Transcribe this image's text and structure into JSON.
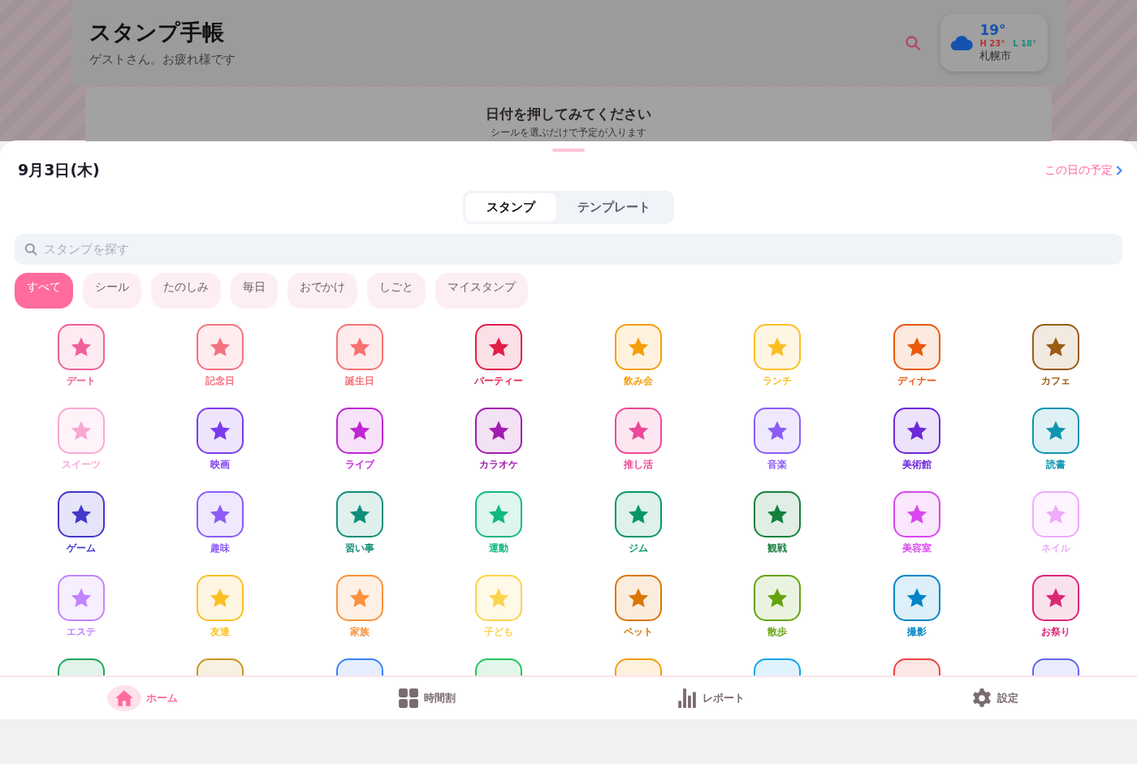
{
  "header": {
    "title": "スタンプ手帳",
    "subtitle": "ゲストさん。お疲れ様です",
    "weather": {
      "temp": "19°",
      "high": "H 23°",
      "low": "L 18°",
      "city": "札幌市"
    }
  },
  "hint_card": {
    "title": "日付を押してみてください",
    "subtitle": "シールを選ぶだけで予定が入ります"
  },
  "sheet": {
    "date": "9月3日(木)",
    "day_link": "この日の予定",
    "tabs": [
      {
        "label": "スタンプ",
        "selected": true
      },
      {
        "label": "テンプレート",
        "selected": false
      }
    ],
    "search": {
      "placeholder": "スタンプを探す"
    },
    "filters": [
      {
        "label": "すべて",
        "selected": true
      },
      {
        "label": "シール",
        "selected": false
      },
      {
        "label": "たのしみ",
        "selected": false
      },
      {
        "label": "毎日",
        "selected": false
      },
      {
        "label": "おでかけ",
        "selected": false
      },
      {
        "label": "しごと",
        "selected": false
      },
      {
        "label": "マイスタンプ",
        "selected": false
      }
    ],
    "stamps": [
      {
        "label": "デート",
        "color": "#f0609a"
      },
      {
        "label": "記念日",
        "color": "#f47280"
      },
      {
        "label": "誕生日",
        "color": "#f87171"
      },
      {
        "label": "パーティー",
        "color": "#e11d48"
      },
      {
        "label": "飲み会",
        "color": "#f59e0b"
      },
      {
        "label": "ランチ",
        "color": "#fbbf24"
      },
      {
        "label": "ディナー",
        "color": "#ea580c"
      },
      {
        "label": "カフェ",
        "color": "#9a5b13"
      },
      {
        "label": "スイーツ",
        "color": "#f9a8d4"
      },
      {
        "label": "映画",
        "color": "#7c3aed"
      },
      {
        "label": "ライブ",
        "color": "#c026d3"
      },
      {
        "label": "カラオケ",
        "color": "#a21caf"
      },
      {
        "label": "推し活",
        "color": "#ec4899"
      },
      {
        "label": "音楽",
        "color": "#8b5cf6"
      },
      {
        "label": "美術館",
        "color": "#6d28d9"
      },
      {
        "label": "読書",
        "color": "#0e94b0"
      },
      {
        "label": "ゲーム",
        "color": "#4338ca"
      },
      {
        "label": "趣味",
        "color": "#8b5cf6"
      },
      {
        "label": "習い事",
        "color": "#0f8f7a"
      },
      {
        "label": "運動",
        "color": "#10b981"
      },
      {
        "label": "ジム",
        "color": "#059669"
      },
      {
        "label": "観戦",
        "color": "#15803d"
      },
      {
        "label": "美容室",
        "color": "#d946ef"
      },
      {
        "label": "ネイル",
        "color": "#f0abfc"
      },
      {
        "label": "エステ",
        "color": "#c084fc"
      },
      {
        "label": "友達",
        "color": "#fbbf24"
      },
      {
        "label": "家族",
        "color": "#fb923c"
      },
      {
        "label": "子ども",
        "color": "#fcd34d"
      },
      {
        "label": "ペット",
        "color": "#d97706"
      },
      {
        "label": "散歩",
        "color": "#65a30d"
      },
      {
        "label": "撮影",
        "color": "#0284c7"
      },
      {
        "label": "お祭り",
        "color": "#db2777"
      },
      {
        "color": "#22a85a"
      },
      {
        "color": "#c8961e"
      },
      {
        "color": "#3b82f6"
      },
      {
        "color": "#22c55e"
      },
      {
        "color": "#f59e0b"
      },
      {
        "color": "#0ea5e9"
      },
      {
        "color": "#ef4444"
      },
      {
        "color": "#6366f1"
      }
    ]
  },
  "bottom_nav": [
    {
      "label": "ホーム",
      "selected": true
    },
    {
      "label": "時間割",
      "selected": false
    },
    {
      "label": "レポート",
      "selected": false
    },
    {
      "label": "設定",
      "selected": false
    }
  ]
}
